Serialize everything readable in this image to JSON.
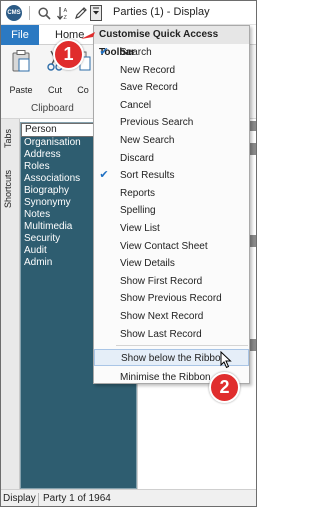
{
  "titlebar": {
    "logo_text": "CMS",
    "title": "Parties (1) - Display"
  },
  "quick_access": {
    "icons": [
      "search-icon",
      "sort-icon",
      "pen-icon",
      "chevron-down-icon"
    ]
  },
  "ribbon": {
    "tabs": [
      "File",
      "Home"
    ],
    "buttons": [
      {
        "label": "Paste",
        "icon": "clipboard-icon"
      },
      {
        "label": "Cut",
        "icon": "scissors-icon"
      },
      {
        "label": "Co",
        "icon": "copy-icon"
      }
    ],
    "group_label": "Clipboard"
  },
  "side_tabs": [
    "Tabs",
    "Shortcuts"
  ],
  "nav": {
    "items": [
      "Person",
      "Organisation",
      "Address",
      "Roles",
      "Associations",
      "Biography",
      "Synonymy",
      "Notes",
      "Multimedia",
      "Security",
      "Audit",
      "Admin"
    ],
    "selected": "Person"
  },
  "status": {
    "mode": "Display",
    "count": "Party 1 of 1964"
  },
  "menu": {
    "header": "Customise Quick Access Toolbar",
    "items": [
      {
        "label": "Search",
        "checked": true
      },
      {
        "label": "New Record",
        "checked": false
      },
      {
        "label": "Save Record",
        "checked": false
      },
      {
        "label": "Cancel",
        "checked": false
      },
      {
        "label": "Previous Search",
        "checked": false
      },
      {
        "label": "New Search",
        "checked": false
      },
      {
        "label": "Discard",
        "checked": false
      },
      {
        "label": "Sort Results",
        "checked": true
      },
      {
        "label": "Reports",
        "checked": false
      },
      {
        "label": "Spelling",
        "checked": false
      },
      {
        "label": "View List",
        "checked": false
      },
      {
        "label": "View Contact Sheet",
        "checked": false
      },
      {
        "label": "View Details",
        "checked": false
      },
      {
        "label": "Show First Record",
        "checked": false
      },
      {
        "label": "Show Previous Record",
        "checked": false
      },
      {
        "label": "Show Next Record",
        "checked": false
      },
      {
        "label": "Show Last Record",
        "checked": false
      }
    ],
    "extra_items": [
      {
        "label": "Show below the Ribbon",
        "hover": true
      },
      {
        "label": "Minimise the Ribbon",
        "hover": false
      }
    ],
    "check_glyph": "✔"
  },
  "callouts": [
    "1",
    "2"
  ],
  "colors": {
    "accent": "#2b79c2",
    "nav_bg": "#2e5d70",
    "callout": "#e02d2d"
  }
}
